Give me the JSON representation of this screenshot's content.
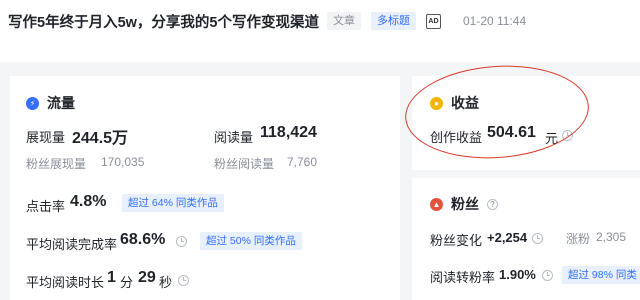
{
  "header": {
    "title": "写作5年终于月入5w，分享我的5个写作变现渠道",
    "tag_article": "文章",
    "tag_multi": "多标题",
    "ad_label": "AD",
    "time": "01-20 11:44"
  },
  "traffic": {
    "title": "流量",
    "impressions_label": "展现量",
    "impressions_value": "244.5万",
    "reads_label": "阅读量",
    "reads_value": "118,424",
    "fan_impressions_label": "粉丝展现量",
    "fan_impressions_value": "170,035",
    "fan_reads_label": "粉丝阅读量",
    "fan_reads_value": "7,760",
    "ctr_label": "点击率",
    "ctr_value": "4.8%",
    "ctr_badge": "超过 64% 同类作品",
    "completion_label": "平均阅读完成率",
    "completion_value": "68.6%",
    "completion_badge": "超过 50% 同类作品",
    "duration_label": "平均阅读时长",
    "duration_min": "1",
    "duration_min_unit": "分",
    "duration_sec": "29",
    "duration_sec_unit": "秒"
  },
  "income": {
    "title": "收益",
    "creation_label": "创作收益",
    "creation_value": "504.61",
    "creation_unit": "元"
  },
  "fans": {
    "title": "粉丝",
    "change_label": "粉丝变化",
    "change_value": "+2,254",
    "gain_label": "涨粉",
    "gain_value": "2,305",
    "conversion_label": "阅读转粉率",
    "conversion_value": "1.90%",
    "conversion_badge": "超过 98% 同类"
  },
  "colors": {
    "accent": "#3370ff",
    "traffic_icon": "#3370ff",
    "income_icon": "#f5b400",
    "fans_icon": "#e5533d",
    "annotation": "#d93a2b"
  },
  "icons": {
    "traffic": "lightning-icon",
    "income": "coin-icon",
    "fans": "person-icon"
  }
}
